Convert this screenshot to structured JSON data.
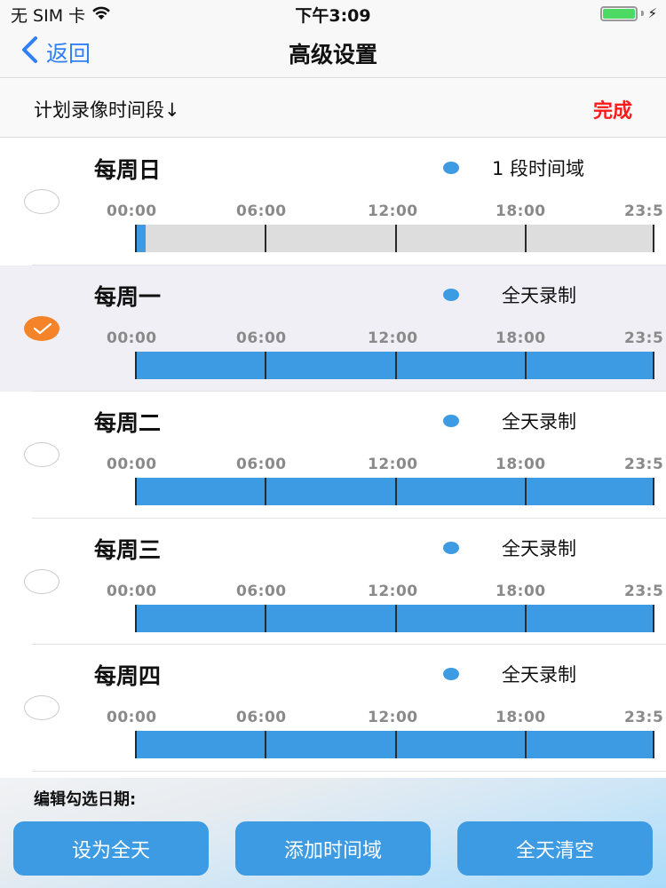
{
  "status_bar": {
    "carrier": "无 SIM 卡",
    "time": "下午3:09",
    "battery_level_percent": 100,
    "charging": true,
    "icons": {
      "wifi": "wifi-icon",
      "battery": "battery-icon",
      "charging": "bolt-icon"
    }
  },
  "nav": {
    "back_label": "返回",
    "title": "高级设置"
  },
  "sub_header": {
    "title": "计划录像时间段↓",
    "done_label": "完成"
  },
  "colors": {
    "accent_blue": "#3c9be2",
    "check_orange": "#f5832a",
    "done_red": "#ff1a1a",
    "back_blue": "#2f7ff5",
    "timeline_empty": "#dddddd"
  },
  "timeline_ticks": [
    "00:00",
    "06:00",
    "12:00",
    "18:00",
    "23:5"
  ],
  "days": [
    {
      "name": "每周日",
      "status": "1 段时间域",
      "checked": false,
      "segments": [
        [
          0.0,
          0.5
        ]
      ]
    },
    {
      "name": "每周一",
      "status": "全天录制",
      "checked": true,
      "segments": [
        [
          0.0,
          24.0
        ]
      ]
    },
    {
      "name": "每周二",
      "status": "全天录制",
      "checked": false,
      "segments": [
        [
          0.0,
          24.0
        ]
      ]
    },
    {
      "name": "每周三",
      "status": "全天录制",
      "checked": false,
      "segments": [
        [
          0.0,
          24.0
        ]
      ]
    },
    {
      "name": "每周四",
      "status": "全天录制",
      "checked": false,
      "segments": [
        [
          0.0,
          24.0
        ]
      ]
    }
  ],
  "bottom": {
    "edit_label": "编辑勾选日期:",
    "buttons": [
      {
        "label": "设为全天"
      },
      {
        "label": "添加时间域"
      },
      {
        "label": "全天清空"
      }
    ]
  }
}
